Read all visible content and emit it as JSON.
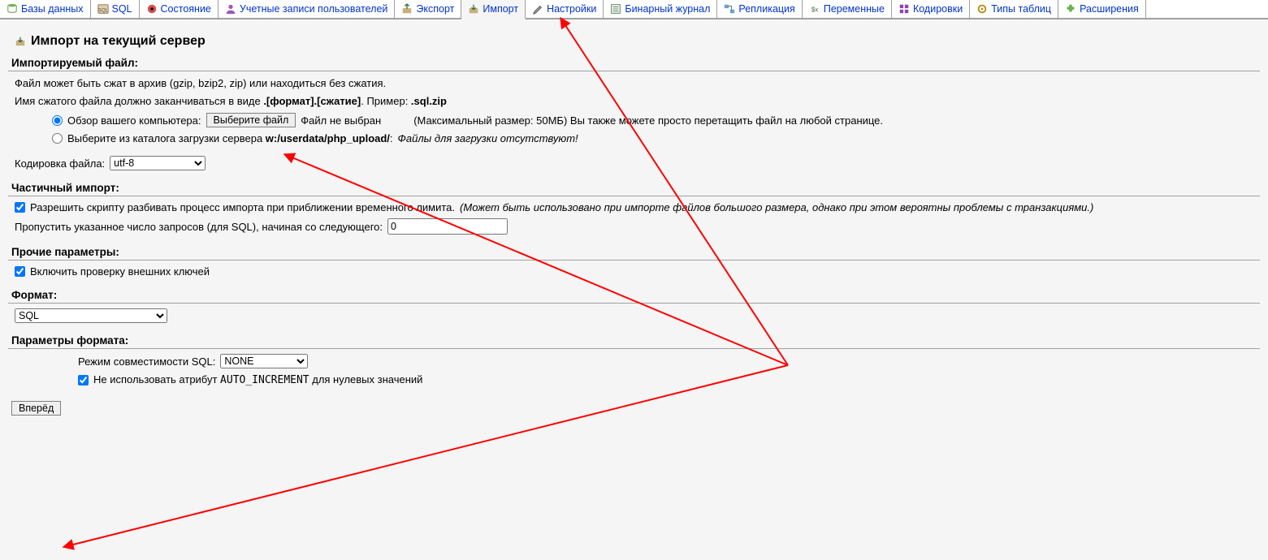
{
  "tabs": [
    {
      "key": "databases",
      "label": "Базы данных"
    },
    {
      "key": "sql",
      "label": "SQL"
    },
    {
      "key": "status",
      "label": "Состояние"
    },
    {
      "key": "users",
      "label": "Учетные записи пользователей"
    },
    {
      "key": "export",
      "label": "Экспорт"
    },
    {
      "key": "import",
      "label": "Импорт"
    },
    {
      "key": "settings",
      "label": "Настройки"
    },
    {
      "key": "binlog",
      "label": "Бинарный журнал"
    },
    {
      "key": "replication",
      "label": "Репликация"
    },
    {
      "key": "variables",
      "label": "Переменные"
    },
    {
      "key": "charsets",
      "label": "Кодировки"
    },
    {
      "key": "engines",
      "label": "Типы таблиц"
    },
    {
      "key": "plugins",
      "label": "Расширения"
    }
  ],
  "active_tab": "import",
  "page_title": "Импорт на текущий сервер",
  "file_section": {
    "head": "Импортируемый файл:",
    "line1": "Файл может быть сжат в архив (gzip, bzip2, zip) или находиться без сжатия.",
    "line2_a": "Имя сжатого файла должно заканчиваться в виде ",
    "line2_b": ".[формат].[сжатие]",
    "line2_c": ". Пример: ",
    "line2_d": ".sql.zip",
    "browse_label": "Обзор вашего компьютера:",
    "choose_btn": "Выберите файл",
    "no_file": "Файл не выбран",
    "max_note": "(Максимальный размер: 50МБ) Вы также можете просто перетащить файл на любой странице.",
    "server_label_a": "Выберите из каталога загрузки сервера ",
    "server_path": "w:/userdata/php_upload/",
    "server_label_b": ":",
    "server_empty": "Файлы для загрузки отсутствуют!",
    "charset_label": "Кодировка файла:",
    "charset_value": "utf-8"
  },
  "partial_section": {
    "head": "Частичный импорт:",
    "allow_label": "Разрешить скрипту разбивать процесс импорта при приближении временного лимита.",
    "allow_hint": "(Может быть использовано при импорте файлов большого размера, однако при этом вероятны проблемы с транзакциями.)",
    "skip_label": "Пропустить указанное число запросов (для SQL), начиная со следующего:",
    "skip_value": "0"
  },
  "other_section": {
    "head": "Прочие параметры:",
    "fk_label": "Включить проверку внешних ключей"
  },
  "format_section": {
    "head": "Формат:",
    "value": "SQL"
  },
  "fmtopts_section": {
    "head": "Параметры формата:",
    "compat_label": "Режим совместимости SQL:",
    "compat_value": "NONE",
    "noautoinc_a": "Не использовать атрибут ",
    "noautoinc_code": "AUTO_INCREMENT",
    "noautoinc_b": " для нулевых значений"
  },
  "submit_label": "Вперёд"
}
